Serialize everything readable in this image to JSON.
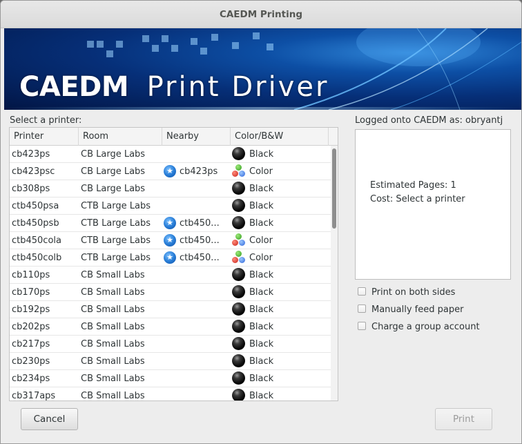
{
  "window": {
    "title": "CAEDM Printing"
  },
  "banner": {
    "title_part1": "CAEDM",
    "title_part2": "Print Driver"
  },
  "printer_list": {
    "label": "Select a printer:",
    "columns": [
      "Printer",
      "Room",
      "Nearby",
      "Color/B&W"
    ],
    "rows": [
      {
        "printer": "cb423ps",
        "room": "CB Large Labs",
        "nearby": "",
        "type": "Black"
      },
      {
        "printer": "cb423psc",
        "room": "CB Large Labs",
        "nearby": "cb423ps",
        "type": "Color"
      },
      {
        "printer": "cb308ps",
        "room": "CB Large Labs",
        "nearby": "",
        "type": "Black"
      },
      {
        "printer": "ctb450psa",
        "room": "CTB Large Labs",
        "nearby": "",
        "type": "Black"
      },
      {
        "printer": "ctb450psb",
        "room": "CTB Large Labs",
        "nearby": "ctb450...",
        "type": "Black"
      },
      {
        "printer": "ctb450cola",
        "room": "CTB Large Labs",
        "nearby": "ctb450...",
        "type": "Color"
      },
      {
        "printer": "ctb450colb",
        "room": "CTB Large Labs",
        "nearby": "ctb450...",
        "type": "Color"
      },
      {
        "printer": "cb110ps",
        "room": "CB Small Labs",
        "nearby": "",
        "type": "Black"
      },
      {
        "printer": "cb170ps",
        "room": "CB Small Labs",
        "nearby": "",
        "type": "Black"
      },
      {
        "printer": "cb192ps",
        "room": "CB Small Labs",
        "nearby": "",
        "type": "Black"
      },
      {
        "printer": "cb202ps",
        "room": "CB Small Labs",
        "nearby": "",
        "type": "Black"
      },
      {
        "printer": "cb217ps",
        "room": "CB Small Labs",
        "nearby": "",
        "type": "Black"
      },
      {
        "printer": "cb230ps",
        "room": "CB Small Labs",
        "nearby": "",
        "type": "Black"
      },
      {
        "printer": "cb234ps",
        "room": "CB Small Labs",
        "nearby": "",
        "type": "Black"
      },
      {
        "printer": "cb317aps",
        "room": "CB Small Labs",
        "nearby": "",
        "type": "Black"
      }
    ]
  },
  "account": {
    "logged_on": "Logged onto CAEDM as: obryantj"
  },
  "info": {
    "pages": "Estimated Pages: 1",
    "cost": "Cost: Select a printer"
  },
  "options": [
    {
      "label": "Print on both sides",
      "checked": false
    },
    {
      "label": "Manually feed paper",
      "checked": false
    },
    {
      "label": "Charge a group account",
      "checked": false
    }
  ],
  "buttons": {
    "cancel": "Cancel",
    "print": "Print"
  },
  "icons": {
    "nearby": "nearby-star-icon",
    "black": "black-ink-icon",
    "color": "color-ink-icon"
  }
}
